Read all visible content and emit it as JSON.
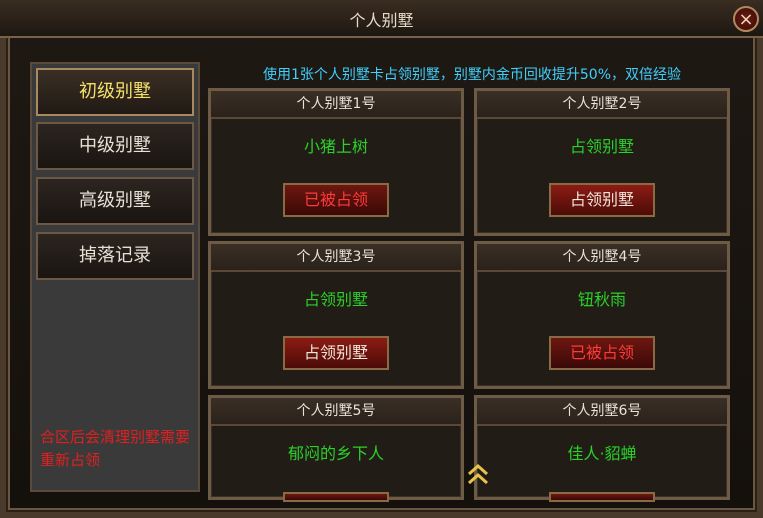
{
  "window": {
    "title": "个人别墅",
    "close_label": "×"
  },
  "sidebar": {
    "items": [
      {
        "label": "初级别墅",
        "active": true
      },
      {
        "label": "中级别墅",
        "active": false
      },
      {
        "label": "高级别墅",
        "active": false
      },
      {
        "label": "掉落记录",
        "active": false
      }
    ],
    "note": "合区后会清理别墅需要重新占领"
  },
  "main": {
    "tip": "使用1张个人别墅卡占领别墅，别墅内金币回收提升50%，双倍经验",
    "villas": [
      {
        "title": "个人别墅1号",
        "owner": "小猪上树",
        "button": "已被占领",
        "taken": true
      },
      {
        "title": "个人别墅2号",
        "owner": "占领别墅",
        "button": "占领别墅",
        "taken": false
      },
      {
        "title": "个人别墅3号",
        "owner": "占领别墅",
        "button": "占领别墅",
        "taken": false
      },
      {
        "title": "个人别墅4号",
        "owner": "钮秋雨",
        "button": "已被占领",
        "taken": true
      },
      {
        "title": "个人别墅5号",
        "owner": "郁闷的乡下人",
        "button": "",
        "taken": true
      },
      {
        "title": "个人别墅6号",
        "owner": "佳人·貂蝉",
        "button": "",
        "taken": true
      }
    ]
  },
  "colors": {
    "taken_text": "#ff3a3a",
    "owner_text": "#29d129",
    "tip_text": "#3fd0ff",
    "active_tab": "#f5e06a"
  }
}
